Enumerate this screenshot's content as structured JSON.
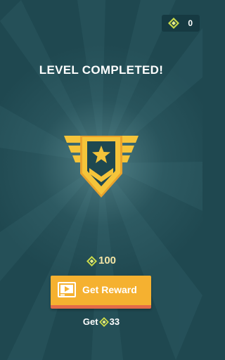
{
  "header": {
    "currency_icon": "gem-icon",
    "currency_value": "0"
  },
  "title": "LEVEL COMPLETED!",
  "badge": {
    "icon": "rank-badge-star-icon",
    "colors": {
      "gold": "#f5c43a",
      "gold_dark": "#d48a1f",
      "teal": "#1f4850"
    }
  },
  "reward": {
    "icon": "gem-icon",
    "amount": "100"
  },
  "reward_button": {
    "icon": "video-ad-icon",
    "label": "Get Reward"
  },
  "alt_reward": {
    "prefix": "Get",
    "icon": "gem-icon",
    "amount": "33"
  },
  "colors": {
    "background": "#1f4850",
    "button": "#f5b130",
    "button_shadow": "#e36a48",
    "reward_text": "#f3e5a6"
  }
}
